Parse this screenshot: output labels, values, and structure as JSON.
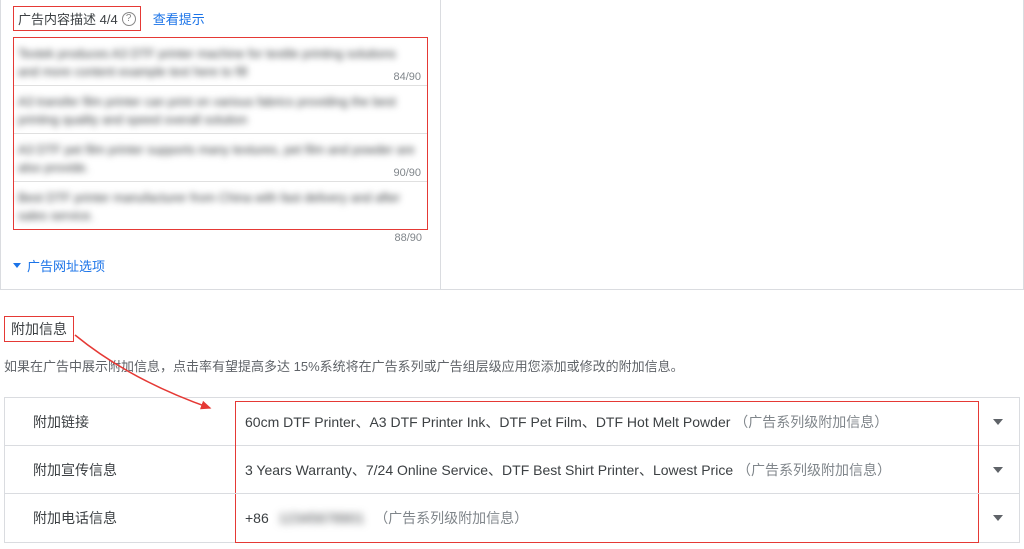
{
  "descSection": {
    "title": "广告内容描述 4/4",
    "helpGlyph": "?",
    "viewHint": "查看提示",
    "items": [
      {
        "text": "Textek produces A3 DTF printer machine for textile printing solutions and more content example text here to fill",
        "count": "84/90"
      },
      {
        "text": "A3 transfer film printer can print on various fabrics providing the best printing quality and speed overall solution",
        "count": ""
      },
      {
        "text": "A3 DTF pet film printer supports many textures, pet film and powder are also provide.",
        "count": "90/90"
      },
      {
        "text": "Best DTF printer manufacturer from China with fast delivery and after sales service.",
        "count": ""
      }
    ],
    "outerCount": "88/90",
    "urlOptions": "广告网址选项"
  },
  "addonSection": {
    "title": "附加信息",
    "subtext": "如果在广告中展示附加信息，点击率有望提高多达 15%系统将在广告系列或广告组层级应用您添加或修改的附加信息。",
    "rows": [
      {
        "label": "附加链接",
        "value": "60cm DTF Printer、A3 DTF Printer Ink、DTF Pet Film、DTF Hot Melt Powder",
        "suffix": "（广告系列级附加信息）"
      },
      {
        "label": "附加宣传信息",
        "value": "3 Years Warranty、7/24 Online Service、DTF Best Shirt Printer、Lowest Price",
        "suffix": "（广告系列级附加信息）"
      },
      {
        "label": "附加电话信息",
        "phonePrefix": "+86",
        "phoneMasked": "12345678901",
        "suffix": "（广告系列级附加信息）"
      }
    ]
  }
}
